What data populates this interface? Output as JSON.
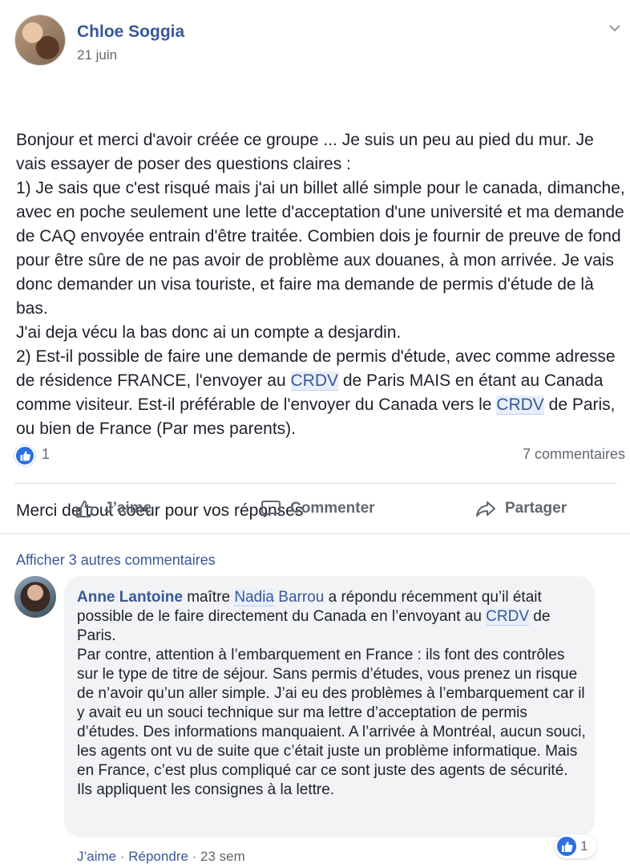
{
  "post": {
    "author": "Chloe Soggia",
    "date": "21 juin",
    "paragraphs": {
      "p1_a": "Bonjour et merci d'avoir créée ce groupe ... Je suis un peu au pied du mur. Je vais essayer de poser des questions claires :\n1) Je sais que c'est risqué mais j'ai un billet allé simple pour le canada, dimanche, avec en poche seulement une lette d'acceptation d'une université et ma demande de CAQ envoyée entrain d'être traitée. Combien dois je fournir de preuve de fond pour être sûre de ne pas avoir de problème aux douanes, à mon arrivée. Je vais donc demander un visa touriste, et faire ma demande de permis d'étude de là bas.\nJ'ai deja vécu la bas donc ai un compte a desjardin.\n2) Est-il possible de faire une demande de permis d'étude, avec comme adresse de résidence FRANCE, l'envoyer au ",
      "link1": "CRDV",
      "p1_b": " de Paris MAIS en étant au Canada comme visiteur. Est-il préférable de l'envoyer du Canada vers le ",
      "link2": "CRDV",
      "p1_c": " de Paris, ou bien de France (Par mes parents).",
      "p2": "Merci de tout coeur pour vos réponses"
    }
  },
  "reactions": {
    "like_count": "1",
    "comment_count": "7 commentaires"
  },
  "actions": {
    "like": "J’aime",
    "comment": "Commenter",
    "share": "Partager"
  },
  "more_comments": "Afficher 3 autres commentaires",
  "comment": {
    "author": "Anne Lantoine",
    "t1": " maître ",
    "mention_first": "Nadia",
    "mention_last": " Barrou",
    "t2": " a répondu récemment qu’il était possible de le faire directement du Canada en l’envoyant au ",
    "link": "CRDV",
    "t3": " de Paris.\nPar contre, attention à l’embarquement en France : ils font des contrôles sur le type de titre de séjour. Sans permis d’études, vous prenez un risque de n’avoir qu’un aller simple. J’ai eu des problèmes à l’embarquement car il y avait eu un souci technique sur ma lettre d’acceptation de permis d’études. Des informations manquaient. A l’arrivée à Montréal, aucun souci, les agents ont vu de suite que c’était juste un problème informatique. Mais en France, c’est plus compliqué car ce sont juste des agents de sécurité. Ils appliquent les consignes à la lettre.",
    "reaction_count": "1",
    "like_label": "J’aime",
    "sep": " · ",
    "reply_label": "Répondre",
    "time": "23 sem"
  },
  "icons": {
    "menu": "chevron-down-icon",
    "like_badge": "thumbs-up-icon",
    "like_action": "thumbs-up-outline-icon",
    "comment_action": "speech-bubble-icon",
    "share_action": "share-arrow-icon"
  },
  "colors": {
    "link": "#385898",
    "like_badge": "#2c6fe6",
    "text": "#1d2129",
    "muted": "#606770",
    "bubble": "#f2f3f5"
  }
}
